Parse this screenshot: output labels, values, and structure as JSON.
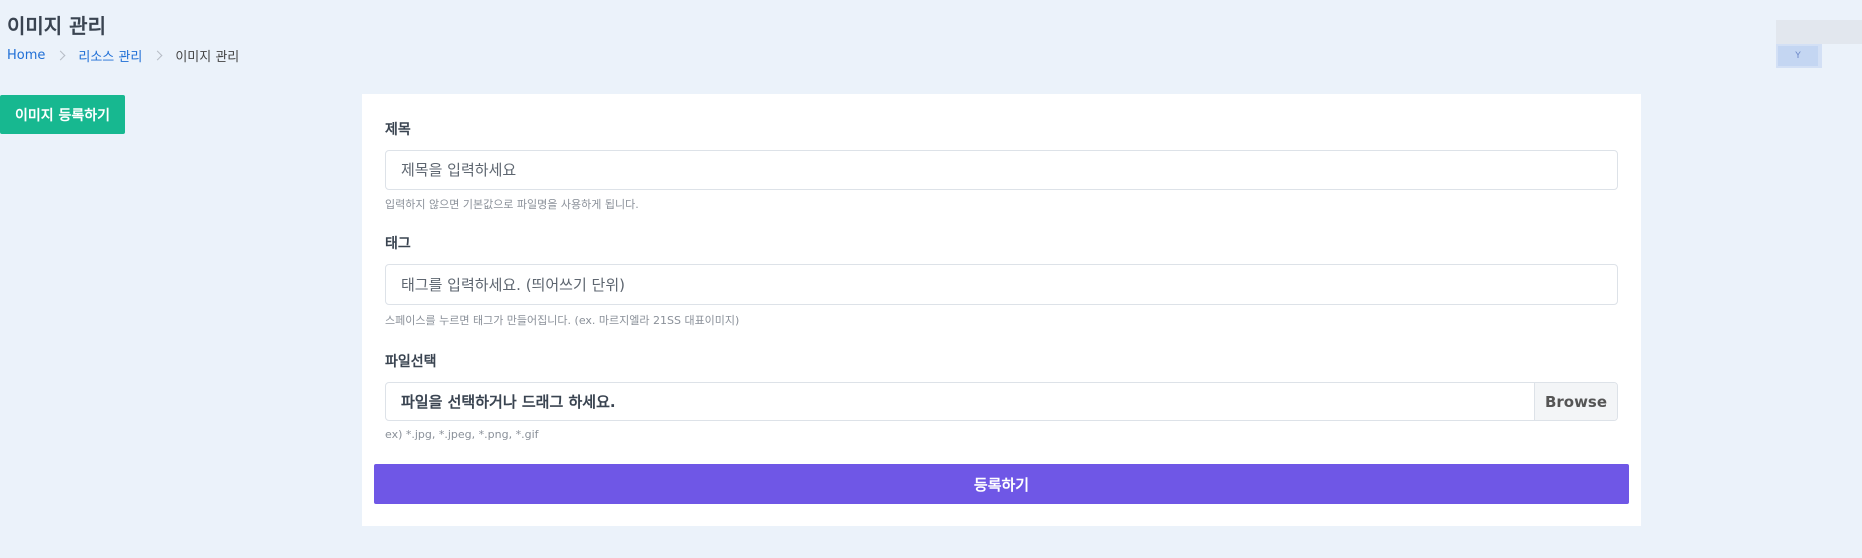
{
  "header": {
    "title": "이미지 관리",
    "breadcrumb": [
      "Home",
      "리소스 관리",
      "이미지 관리"
    ]
  },
  "user": {
    "avatar_text": "Y"
  },
  "actions": {
    "register_label": "이미지 등록하기"
  },
  "form": {
    "title_label": "제목",
    "title_placeholder": "제목을 입력하세요",
    "title_help": "입력하지 않으면 기본값으로 파일명을 사용하게 됩니다.",
    "tag_label": "태그",
    "tag_placeholder": "태그를 입력하세요. (띄어쓰기 단위)",
    "tag_help": "스페이스를 누르면 태그가 만들어집니다. (ex. 마르지엘라 21SS 대표이미지)",
    "file_label": "파일선택",
    "file_placeholder": "파일을 선택하거나 드래그 하세요.",
    "browse_label": "Browse",
    "file_help": "ex) *.jpg, *.jpeg, *.png, *.gif",
    "submit_label": "등록하기"
  },
  "colors": {
    "background": "#ebf2fa",
    "register_button": "#17b890",
    "submit_button": "#6f57e6",
    "link": "#1f6fd6"
  }
}
